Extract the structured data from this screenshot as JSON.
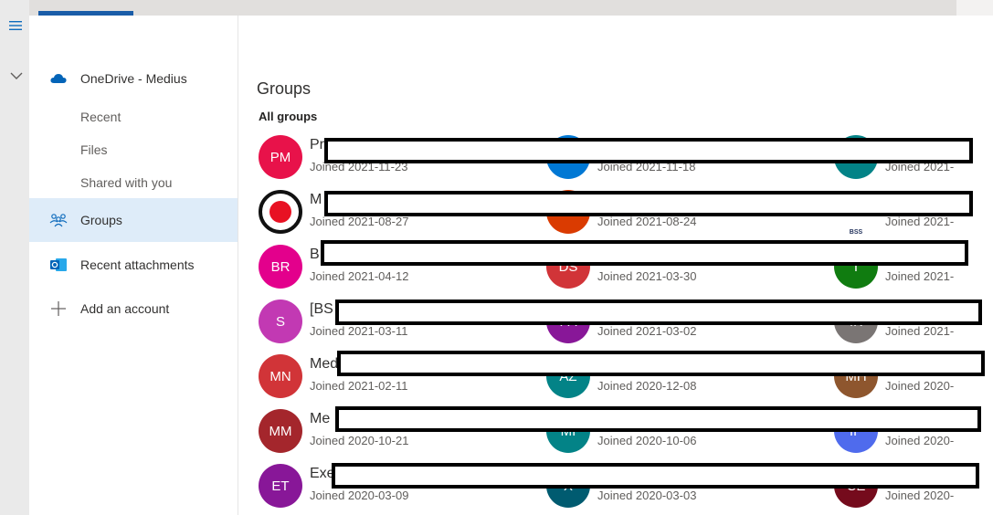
{
  "sidebar": {
    "account": "OneDrive - Medius",
    "items": [
      {
        "label": "Recent"
      },
      {
        "label": "Files"
      },
      {
        "label": "Shared with you"
      },
      {
        "label": "Groups"
      },
      {
        "label": "Recent attachments"
      },
      {
        "label": "Add an account"
      }
    ]
  },
  "main": {
    "title": "Groups",
    "subtitle": "All groups",
    "rows": [
      [
        {
          "initials": "PM",
          "color": "#e8124a",
          "name": "Pr",
          "joined": "Joined 2021-11-23"
        },
        {
          "initials": "",
          "color": "#0078d4",
          "name": "",
          "joined": "Joined 2021-11-18"
        },
        {
          "initials": "",
          "color": "#038387",
          "name": "",
          "joined": "Joined 2021-"
        }
      ],
      [
        {
          "initials": "",
          "color": "#ffffff",
          "name": "M",
          "joined": "Joined 2021-08-27",
          "logo": "record"
        },
        {
          "initials": "",
          "color": "#da3b01",
          "name": "",
          "joined": "Joined 2021-08-24"
        },
        {
          "initials": "BSS",
          "color": "#ffffff",
          "name": "",
          "joined": "Joined 2021-",
          "logo": "bss"
        }
      ],
      [
        {
          "initials": "BR",
          "color": "#e3008c",
          "name": "B",
          "joined": "Joined 2021-04-12"
        },
        {
          "initials": "DS",
          "color": "#d13438",
          "name": "",
          "joined": "Joined 2021-03-30"
        },
        {
          "initials": "T",
          "color": "#107c10",
          "name": "",
          "joined": "Joined 2021-"
        }
      ],
      [
        {
          "initials": "S",
          "color": "#c239b3",
          "name": "[BS",
          "joined": "Joined 2021-03-11"
        },
        {
          "initials": "PA",
          "color": "#881798",
          "name": "",
          "joined": "Joined 2021-03-02"
        },
        {
          "initials": "IK",
          "color": "#7a7574",
          "name": "",
          "joined": "Joined 2021-"
        }
      ],
      [
        {
          "initials": "MN",
          "color": "#d13438",
          "name": "Med",
          "joined": "Joined 2021-02-11"
        },
        {
          "initials": "AZ",
          "color": "#038387",
          "name": "",
          "joined": "Joined 2020-12-08"
        },
        {
          "initials": "MH",
          "color": "#8e562e",
          "name": "",
          "joined": "Joined 2020-"
        }
      ],
      [
        {
          "initials": "MM",
          "color": "#a4262c",
          "name": "Me",
          "joined": "Joined 2020-10-21"
        },
        {
          "initials": "MI",
          "color": "#038387",
          "name": "",
          "joined": "Joined 2020-10-06"
        },
        {
          "initials": "IP",
          "color": "#4f6bed",
          "name": "",
          "joined": "Joined 2020-"
        }
      ],
      [
        {
          "initials": "ET",
          "color": "#881798",
          "name": "Exe",
          "joined": "Joined 2020-03-09"
        },
        {
          "initials": "X",
          "color": "#005b70",
          "name": "",
          "joined": "Joined 2020-03-03"
        },
        {
          "initials": "CE",
          "color": "#750b1c",
          "name": "",
          "joined": "Joined 2020-"
        }
      ]
    ]
  }
}
